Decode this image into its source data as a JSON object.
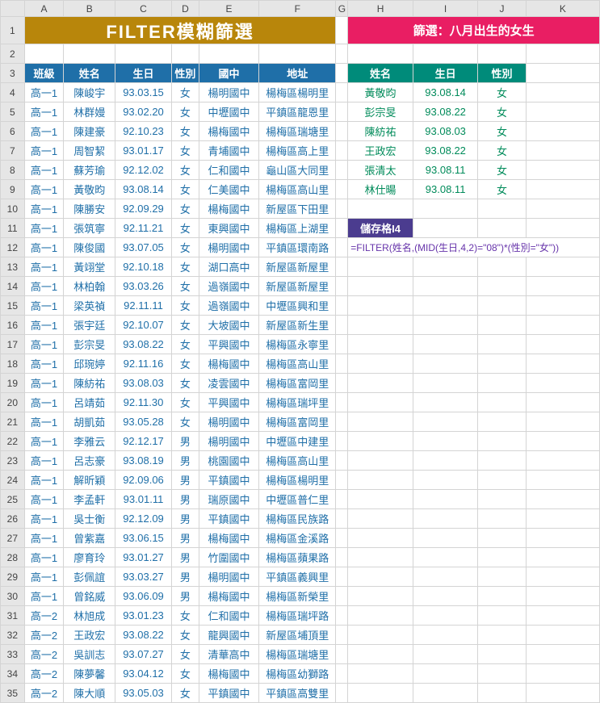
{
  "cols": [
    "",
    "A",
    "B",
    "C",
    "D",
    "E",
    "F",
    "G",
    "H",
    "I",
    "J",
    "K"
  ],
  "title_main": "FILTER模糊篩選",
  "title_right": "篩選：八月出生的女生",
  "left_headers": [
    "班級",
    "姓名",
    "生日",
    "性別",
    "國中",
    "地址"
  ],
  "right_headers": [
    "姓名",
    "生日",
    "性別"
  ],
  "rows": [
    {
      "n": 4,
      "c": "高一1",
      "nm": "陳峻宇",
      "d": "93.03.15",
      "g": "女",
      "s": "楊明國中",
      "a": "楊梅區楊明里"
    },
    {
      "n": 5,
      "c": "高一1",
      "nm": "林群嫚",
      "d": "93.02.20",
      "g": "女",
      "s": "中壢國中",
      "a": "平鎮區龍恩里"
    },
    {
      "n": 6,
      "c": "高一1",
      "nm": "陳建豪",
      "d": "92.10.23",
      "g": "女",
      "s": "楊梅國中",
      "a": "楊梅區瑞塘里"
    },
    {
      "n": 7,
      "c": "高一1",
      "nm": "周智絜",
      "d": "93.01.17",
      "g": "女",
      "s": "青埔國中",
      "a": "楊梅區高上里"
    },
    {
      "n": 8,
      "c": "高一1",
      "nm": "蘇芳瑜",
      "d": "92.12.02",
      "g": "女",
      "s": "仁和國中",
      "a": "龜山區大同里"
    },
    {
      "n": 9,
      "c": "高一1",
      "nm": "黃敬昀",
      "d": "93.08.14",
      "g": "女",
      "s": "仁美國中",
      "a": "楊梅區高山里"
    },
    {
      "n": 10,
      "c": "高一1",
      "nm": "陳勝安",
      "d": "92.09.29",
      "g": "女",
      "s": "楊梅國中",
      "a": "新屋區下田里"
    },
    {
      "n": 11,
      "c": "高一1",
      "nm": "張筑寧",
      "d": "92.11.21",
      "g": "女",
      "s": "東興國中",
      "a": "楊梅區上湖里"
    },
    {
      "n": 12,
      "c": "高一1",
      "nm": "陳俊國",
      "d": "93.07.05",
      "g": "女",
      "s": "楊明國中",
      "a": "平鎮區環南路"
    },
    {
      "n": 13,
      "c": "高一1",
      "nm": "黃翊堂",
      "d": "92.10.18",
      "g": "女",
      "s": "湖口高中",
      "a": "新屋區新屋里"
    },
    {
      "n": 14,
      "c": "高一1",
      "nm": "林柏翰",
      "d": "93.03.26",
      "g": "女",
      "s": "過嶺國中",
      "a": "新屋區新屋里"
    },
    {
      "n": 15,
      "c": "高一1",
      "nm": "梁英禎",
      "d": "92.11.11",
      "g": "女",
      "s": "過嶺國中",
      "a": "中壢區興和里"
    },
    {
      "n": 16,
      "c": "高一1",
      "nm": "張宇廷",
      "d": "92.10.07",
      "g": "女",
      "s": "大坡國中",
      "a": "新屋區新生里"
    },
    {
      "n": 17,
      "c": "高一1",
      "nm": "彭宗旻",
      "d": "93.08.22",
      "g": "女",
      "s": "平興國中",
      "a": "楊梅區永寧里"
    },
    {
      "n": 18,
      "c": "高一1",
      "nm": "邱琬婷",
      "d": "92.11.16",
      "g": "女",
      "s": "楊梅國中",
      "a": "楊梅區高山里"
    },
    {
      "n": 19,
      "c": "高一1",
      "nm": "陳紡祐",
      "d": "93.08.03",
      "g": "女",
      "s": "凌雲國中",
      "a": "楊梅區富岡里"
    },
    {
      "n": 20,
      "c": "高一1",
      "nm": "呂靖茹",
      "d": "92.11.30",
      "g": "女",
      "s": "平興國中",
      "a": "楊梅區瑞坪里"
    },
    {
      "n": 21,
      "c": "高一1",
      "nm": "胡凱茹",
      "d": "93.05.28",
      "g": "女",
      "s": "楊明國中",
      "a": "楊梅區富岡里"
    },
    {
      "n": 22,
      "c": "高一1",
      "nm": "李雅云",
      "d": "92.12.17",
      "g": "男",
      "s": "楊明國中",
      "a": "中壢區中建里"
    },
    {
      "n": 23,
      "c": "高一1",
      "nm": "呂志豪",
      "d": "93.08.19",
      "g": "男",
      "s": "桃園國中",
      "a": "楊梅區高山里"
    },
    {
      "n": 24,
      "c": "高一1",
      "nm": "解昕穎",
      "d": "92.09.06",
      "g": "男",
      "s": "平鎮國中",
      "a": "楊梅區楊明里"
    },
    {
      "n": 25,
      "c": "高一1",
      "nm": "李孟軒",
      "d": "93.01.11",
      "g": "男",
      "s": "瑞原國中",
      "a": "中壢區普仁里"
    },
    {
      "n": 26,
      "c": "高一1",
      "nm": "吳士衡",
      "d": "92.12.09",
      "g": "男",
      "s": "平鎮國中",
      "a": "楊梅區民族路"
    },
    {
      "n": 27,
      "c": "高一1",
      "nm": "曾紫嘉",
      "d": "93.06.15",
      "g": "男",
      "s": "楊梅國中",
      "a": "楊梅區金溪路"
    },
    {
      "n": 28,
      "c": "高一1",
      "nm": "廖育玲",
      "d": "93.01.27",
      "g": "男",
      "s": "竹圍國中",
      "a": "楊梅區蘋果路"
    },
    {
      "n": 29,
      "c": "高一1",
      "nm": "彭佩誼",
      "d": "93.03.27",
      "g": "男",
      "s": "楊明國中",
      "a": "平鎮區義興里"
    },
    {
      "n": 30,
      "c": "高一1",
      "nm": "曾銘威",
      "d": "93.06.09",
      "g": "男",
      "s": "楊梅國中",
      "a": "楊梅區新榮里"
    },
    {
      "n": 31,
      "c": "高一2",
      "nm": "林旭成",
      "d": "93.01.23",
      "g": "女",
      "s": "仁和國中",
      "a": "楊梅區瑞坪路"
    },
    {
      "n": 32,
      "c": "高一2",
      "nm": "王政宏",
      "d": "93.08.22",
      "g": "女",
      "s": "龍興國中",
      "a": "新屋區埔頂里"
    },
    {
      "n": 33,
      "c": "高一2",
      "nm": "吳訓志",
      "d": "93.07.27",
      "g": "女",
      "s": "清華高中",
      "a": "楊梅區瑞塘里"
    },
    {
      "n": 34,
      "c": "高一2",
      "nm": "陳夢馨",
      "d": "93.04.12",
      "g": "女",
      "s": "楊梅國中",
      "a": "楊梅區幼獅路"
    },
    {
      "n": 35,
      "c": "高一2",
      "nm": "陳大順",
      "d": "93.05.03",
      "g": "女",
      "s": "平鎮國中",
      "a": "平鎮區高雙里"
    }
  ],
  "filtered": [
    {
      "nm": "黃敬昀",
      "d": "93.08.14",
      "g": "女"
    },
    {
      "nm": "彭宗旻",
      "d": "93.08.22",
      "g": "女"
    },
    {
      "nm": "陳紡祐",
      "d": "93.08.03",
      "g": "女"
    },
    {
      "nm": "王政宏",
      "d": "93.08.22",
      "g": "女"
    },
    {
      "nm": "張清太",
      "d": "93.08.11",
      "g": "女"
    },
    {
      "nm": "林仕暘",
      "d": "93.08.11",
      "g": "女"
    }
  ],
  "cell_ref_label": "儲存格I4",
  "formula": "=FILTER(姓名,(MID(生日,4,2)=\"08\")*(性別=\"女\"))",
  "row2": "2"
}
